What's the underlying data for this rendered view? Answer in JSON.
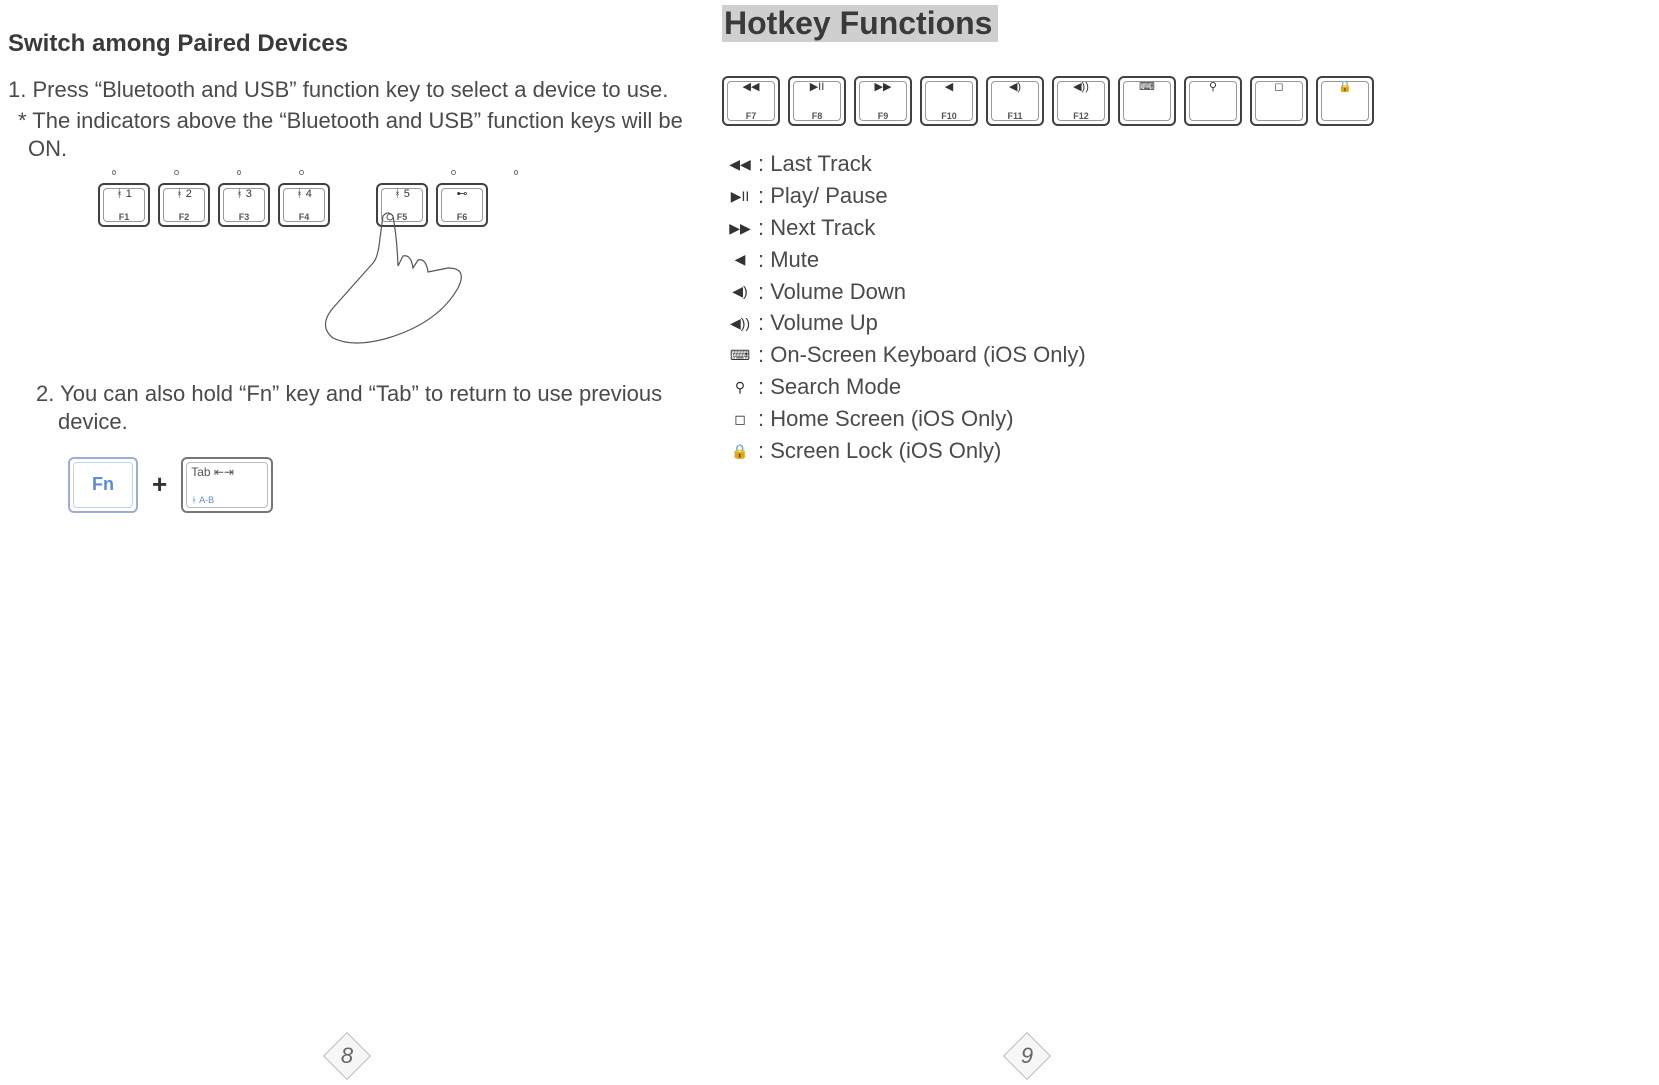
{
  "left": {
    "title": "Switch among Paired Devices",
    "step1": "1. Press “Bluetooth and USB” function key to select a device to use.",
    "note": "* The indicators above the “Bluetooth and USB” function keys will be ON.",
    "step2": "2. You can also hold “Fn” key and “Tab” to return to use previous device.",
    "fn_label": "Fn",
    "tab_label": "Tab",
    "tab_sub": "A-B",
    "device_keys": [
      {
        "icon": "bt1",
        "label": "F1"
      },
      {
        "icon": "bt2",
        "label": "F2"
      },
      {
        "icon": "bt3",
        "label": "F3"
      },
      {
        "icon": "bt4",
        "label": "F4"
      },
      {
        "icon": "bt5",
        "label": "F5"
      },
      {
        "icon": "usb",
        "label": "F6"
      }
    ],
    "page_number": "8"
  },
  "right": {
    "title": "Hotkey Functions",
    "keys": [
      {
        "label": "F7"
      },
      {
        "label": "F8"
      },
      {
        "label": "F9"
      },
      {
        "label": "F10"
      },
      {
        "label": "F11"
      },
      {
        "label": "F12"
      },
      {
        "label": ""
      },
      {
        "label": ""
      },
      {
        "label": ""
      },
      {
        "label": ""
      }
    ],
    "functions": [
      {
        "text": ": Last Track"
      },
      {
        "text": ": Play/ Pause"
      },
      {
        "text": ": Next Track"
      },
      {
        "text": ": Mute"
      },
      {
        "text": ": Volume Down"
      },
      {
        "text": ": Volume Up"
      },
      {
        "text": ": On-Screen Keyboard (iOS Only)"
      },
      {
        "text": ": Search Mode"
      },
      {
        "text": ": Home Screen (iOS Only)"
      },
      {
        "text": ": Screen Lock (iOS Only)"
      }
    ],
    "page_number": "9"
  }
}
